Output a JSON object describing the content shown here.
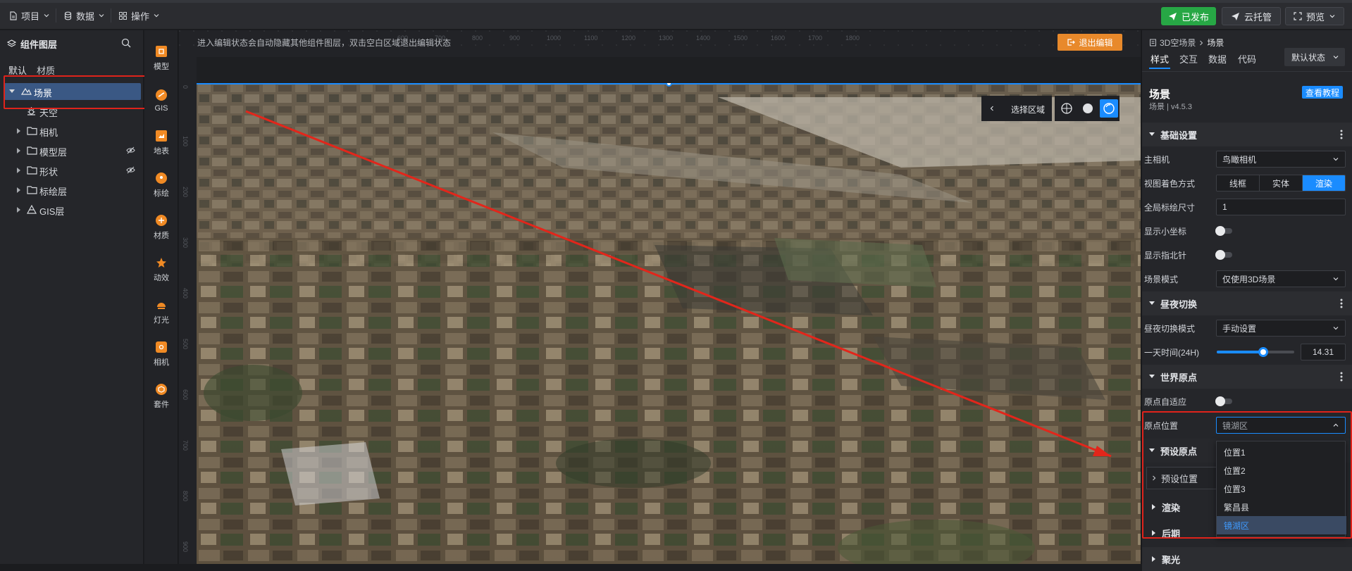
{
  "topbar": {
    "menus": [
      {
        "label": "项目",
        "icon": "document-icon"
      },
      {
        "label": "数据",
        "icon": "database-icon"
      },
      {
        "label": "操作",
        "icon": "grid-icon"
      }
    ],
    "publish_label": "已发布",
    "cloud_label": "云托管",
    "preview_label": "预览",
    "publish_color": "#27a745"
  },
  "left_panel": {
    "title": "组件图层",
    "tabs": [
      "默认",
      "材质"
    ],
    "tree": [
      {
        "label": "场景",
        "icon": "scene-icon",
        "selected": true,
        "level": 0
      },
      {
        "label": "天空",
        "icon": "sky-icon",
        "level": 1
      },
      {
        "label": "相机",
        "icon": "folder-icon",
        "level": 0
      },
      {
        "label": "模型层",
        "icon": "folder-icon",
        "level": 0,
        "hidden": true
      },
      {
        "label": "形状",
        "icon": "folder-icon",
        "level": 0,
        "hidden": true
      },
      {
        "label": "标绘层",
        "icon": "folder-icon",
        "level": 0
      },
      {
        "label": "GIS层",
        "icon": "gis-icon",
        "level": 0
      }
    ]
  },
  "toolbox": {
    "items": [
      {
        "label": "模型",
        "icon": "model-icon"
      },
      {
        "label": "GIS",
        "icon": "gis-icon"
      },
      {
        "label": "地表",
        "icon": "terrain-icon"
      },
      {
        "label": "标绘",
        "icon": "marker-icon"
      },
      {
        "label": "材质",
        "icon": "material-icon"
      },
      {
        "label": "动效",
        "icon": "effect-icon"
      },
      {
        "label": "灯光",
        "icon": "light-icon"
      },
      {
        "label": "相机",
        "icon": "camera-icon"
      },
      {
        "label": "套件",
        "icon": "kit-icon"
      }
    ]
  },
  "canvas": {
    "hint": "进入编辑状态会自动隐藏其他组件图层，双击空白区域退出编辑状态",
    "exit_label": "退出编辑",
    "exit_color": "#e8892b",
    "ruler_ticks": [
      "600",
      "700",
      "800",
      "900",
      "1000",
      "1100",
      "1200",
      "1300",
      "1400",
      "1500",
      "1600",
      "1700",
      "1800"
    ],
    "vruler_ticks": [
      "0",
      "100",
      "200",
      "300",
      "400",
      "500",
      "600",
      "700",
      "800",
      "900"
    ],
    "area_label": "选择区域"
  },
  "right_panel": {
    "breadcrumb": "3D空场景",
    "breadcrumb_current": "场景",
    "tabs": [
      "样式",
      "交互",
      "数据",
      "代码"
    ],
    "state_label": "默认状态",
    "title": "场景",
    "subtitle": "场景 | v4.5.3",
    "tutorial_label": "查看教程",
    "sections": {
      "basic": "基础设置",
      "daynight": "昼夜切换",
      "origin": "世界原点",
      "preset": "预设原点",
      "render": "渲染",
      "post": "后期",
      "focus": "聚光"
    },
    "fields": {
      "main_camera": {
        "label": "主相机",
        "value": "鸟瞰相机"
      },
      "view_color": {
        "label": "视图着色方式",
        "options": [
          "线框",
          "实体",
          "渲染"
        ],
        "active": "渲染"
      },
      "marker_size": {
        "label": "全局标绘尺寸",
        "value": "1"
      },
      "show_axis": {
        "label": "显示小坐标"
      },
      "show_compass": {
        "label": "显示指北针"
      },
      "scene_mode": {
        "label": "场景模式",
        "value": "仅使用3D场景"
      },
      "daynight_mode": {
        "label": "昼夜切换模式",
        "value": "手动设置"
      },
      "time_of_day": {
        "label": "一天时间(24H)",
        "value": "14.31",
        "level": 0.596
      },
      "origin_auto": {
        "label": "原点自适应"
      },
      "origin_pos": {
        "label": "原点位置",
        "value": "镜湖区"
      },
      "preset_pos": {
        "label": "预设位置"
      }
    },
    "dropdown_options": [
      "位置1",
      "位置2",
      "位置3",
      "繁昌县",
      "镜湖区"
    ],
    "dropdown_selected": "镜湖区",
    "accent": "#1a8cff"
  }
}
